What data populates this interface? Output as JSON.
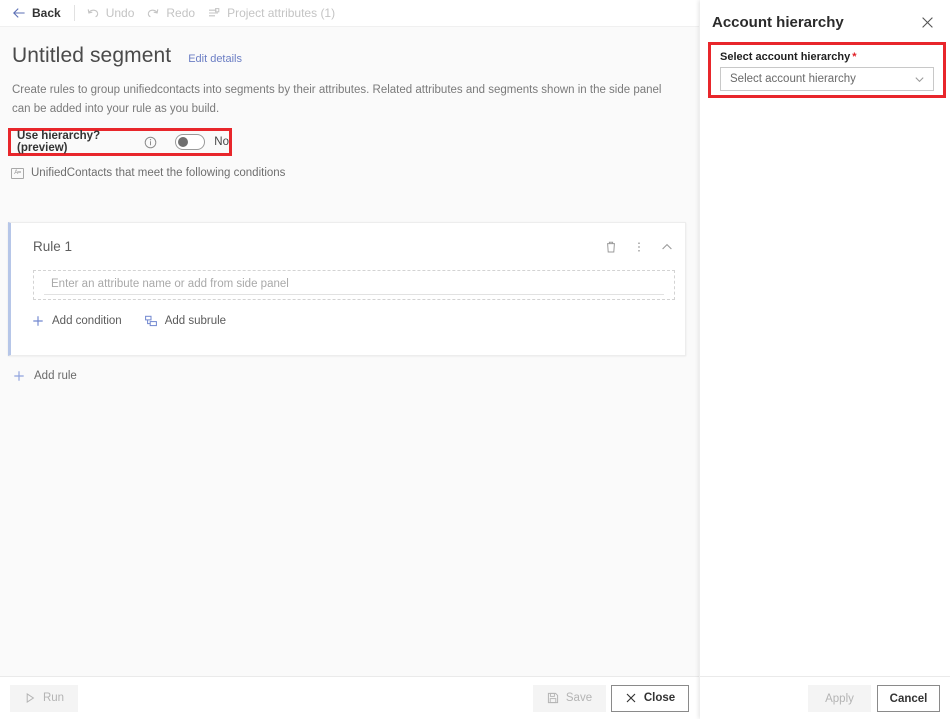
{
  "command_bar": {
    "items": [
      {
        "label": "Back",
        "icon": "arrow-left-icon",
        "enabled": true
      },
      {
        "label": "Undo",
        "icon": "undo-icon",
        "enabled": false
      },
      {
        "label": "Redo",
        "icon": "redo-icon",
        "enabled": false
      },
      {
        "label": "Project attributes (1)",
        "icon": "project-attributes-icon",
        "enabled": false
      }
    ]
  },
  "page": {
    "title": "Untitled segment",
    "edit_details_label": "Edit details",
    "description": "Create rules to group unifiedcontacts into segments by their attributes. Related attributes and segments shown in the side panel can be added into your rule as you build.",
    "hierarchy": {
      "label": "Use hierarchy? (preview)",
      "info_icon": "info-icon",
      "toggle_state": "No",
      "toggle_on": false,
      "highlight_color": "#e8262b"
    },
    "entity_line": {
      "icon": "entity-attribute-icon",
      "icon_text": "A=",
      "text": "UnifiedContacts that meet the following conditions"
    }
  },
  "rule": {
    "title": "Rule 1",
    "actions": [
      {
        "name": "delete-rule-icon",
        "glyph": "trash"
      },
      {
        "name": "more-options-icon",
        "glyph": "ellipsis"
      },
      {
        "name": "collapse-rule-icon",
        "glyph": "chevron-up"
      }
    ],
    "attribute_placeholder": "Enter an attribute name or add from side panel",
    "attribute_value": "",
    "links": [
      {
        "label": "Add condition",
        "icon": "plus-icon"
      },
      {
        "label": "Add subrule",
        "icon": "subrule-icon"
      }
    ],
    "accent_color": "#b6c6e8"
  },
  "add_rule": {
    "label": "Add rule",
    "icon": "plus-icon"
  },
  "main_footer": {
    "run_label": "Run",
    "run_icon": "play-icon",
    "run_enabled": false,
    "save_label": "Save",
    "save_icon": "save-icon",
    "save_enabled": false,
    "close_label": "Close",
    "close_icon": "close-x-icon"
  },
  "side_panel": {
    "title": "Account hierarchy",
    "close_icon": "close-icon",
    "field": {
      "label": "Select account hierarchy",
      "required_marker": "*",
      "select_placeholder": "Select account hierarchy",
      "chevron_icon": "chevron-down-icon",
      "highlight_color": "#e8262b"
    },
    "footer": {
      "apply_label": "Apply",
      "apply_enabled": false,
      "cancel_label": "Cancel"
    }
  }
}
